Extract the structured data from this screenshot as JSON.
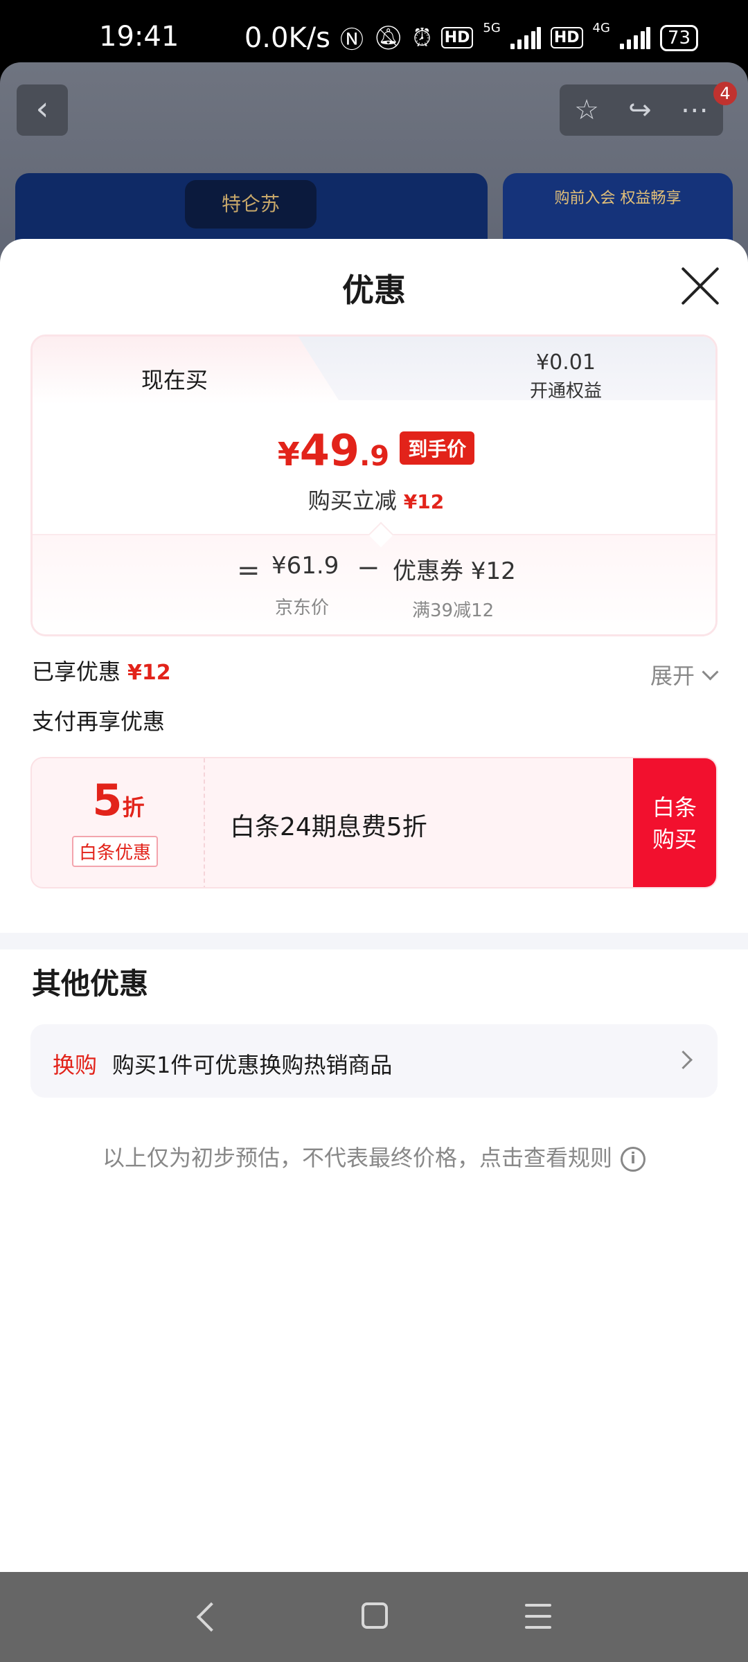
{
  "status_bar": {
    "time": "19:41",
    "net_speed": "0.0K/s",
    "sim1_network": "5G",
    "sim2_network": "4G",
    "hd_label": "HD",
    "battery": "73"
  },
  "background_page": {
    "cart_badge": "4",
    "brand_logo_text": "特仑苏",
    "banner_text": "购前入会 权益畅享"
  },
  "sheet": {
    "title": "优惠",
    "tabs": [
      {
        "label": "现在买"
      },
      {
        "price": "¥0.01",
        "label": "开通权益"
      }
    ],
    "final_price": {
      "yen": "¥",
      "integer": "49",
      "decimal": ".9",
      "tag": "到手价"
    },
    "instant_reduce": {
      "label": "购买立减",
      "amount": "¥12"
    },
    "breakdown": {
      "equals": "=",
      "jd_price": "¥61.9",
      "jd_price_label": "京东价",
      "minus": "−",
      "coupon": "优惠券 ¥12",
      "coupon_label": "满39减12"
    },
    "enjoyed": {
      "label": "已享优惠",
      "amount": "¥12"
    },
    "expand_label": "展开",
    "pay_section_title": "支付再享优惠",
    "baitiao": {
      "discount_number": "5",
      "discount_unit": "折",
      "tag": "白条优惠",
      "description": "白条24期息费5折",
      "button_line1": "白条",
      "button_line2": "购买"
    },
    "other_title": "其他优惠",
    "other_offer": {
      "tag": "换购",
      "text": "购买1件可优惠换购热销商品"
    },
    "disclaimer": "以上仅为初步预估，不代表最终价格，点击查看规则"
  },
  "colors": {
    "accent_red": "#e2231a",
    "button_red": "#f2102e"
  }
}
